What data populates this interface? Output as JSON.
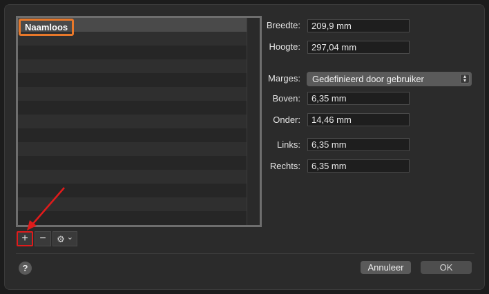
{
  "list": {
    "items": [
      "Naamloos"
    ],
    "selected": "Naamloos"
  },
  "list_controls": {
    "add": "+",
    "remove": "−",
    "gear": "⚙",
    "gear_chevron": "⌄"
  },
  "form": {
    "width_label": "Breedte:",
    "width_value": "209,9 mm",
    "height_label": "Hoogte:",
    "height_value": "297,04 mm",
    "margins_label": "Marges:",
    "margins_value": "Gedefinieerd door gebruiker",
    "top_label": "Boven:",
    "top_value": "6,35 mm",
    "bottom_label": "Onder:",
    "bottom_value": "14,46 mm",
    "left_label": "Links:",
    "left_value": "6,35 mm",
    "right_label": "Rechts:",
    "right_value": "6,35 mm"
  },
  "footer": {
    "help": "?",
    "cancel": "Annuleer",
    "ok": "OK"
  },
  "colors": {
    "highlight_selected": "#e8782a",
    "highlight_add": "#e01b1b"
  }
}
